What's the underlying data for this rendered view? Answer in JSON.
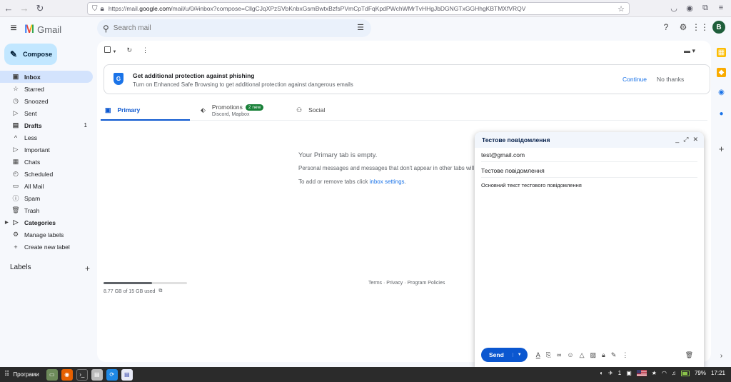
{
  "browser": {
    "url_prefix": "https://mail.",
    "url_host": "google.com",
    "url_rest": "/mail/u/0/#inbox?compose=CllgCJqXPzSVbKnbxGsmBwtxBzfsPVmCpTdFqKpdPWchWMrTvHHgJbDGNGTxGGHhgKBTMXfVRQV"
  },
  "header": {
    "app_name": "Gmail",
    "search_placeholder": "Search mail",
    "avatar_letter": "B"
  },
  "sidebar": {
    "compose_label": "Compose",
    "items": [
      {
        "label": "Inbox",
        "count": ""
      },
      {
        "label": "Starred",
        "count": ""
      },
      {
        "label": "Snoozed",
        "count": ""
      },
      {
        "label": "Sent",
        "count": ""
      },
      {
        "label": "Drafts",
        "count": "1"
      },
      {
        "label": "Less",
        "count": ""
      },
      {
        "label": "Important",
        "count": ""
      },
      {
        "label": "Chats",
        "count": ""
      },
      {
        "label": "Scheduled",
        "count": ""
      },
      {
        "label": "All Mail",
        "count": ""
      },
      {
        "label": "Spam",
        "count": ""
      },
      {
        "label": "Trash",
        "count": ""
      },
      {
        "label": "Categories",
        "count": ""
      },
      {
        "label": "Manage labels",
        "count": ""
      },
      {
        "label": "Create new label",
        "count": ""
      }
    ],
    "labels_heading": "Labels"
  },
  "banner": {
    "title": "Get additional protection against phishing",
    "subtitle": "Turn on Enhanced Safe Browsing to get additional protection against dangerous emails",
    "continue_label": "Continue",
    "no_thanks_label": "No thanks"
  },
  "tabs": {
    "primary": "Primary",
    "promotions": "Promotions",
    "promotions_badge": "2 new",
    "promotions_sub": "Discord, Mapbox",
    "social": "Social"
  },
  "empty_state": {
    "title": "Your Primary tab is empty.",
    "line1": "Personal messages and messages that don't appear in other tabs will be",
    "line2_prefix": "To add or remove tabs click ",
    "line2_link": "inbox settings",
    "line2_suffix": "."
  },
  "storage": {
    "text": "8.77 GB of 15 GB used",
    "used_fraction": 0.585
  },
  "footer": {
    "links": "Terms · Privacy · Program Policies"
  },
  "compose": {
    "title": "Тестове повідомлення",
    "to": "test@gmail.com",
    "subject": "Тестове повідомлення",
    "body": "Основний текст тестового повідомлення",
    "send_label": "Send"
  },
  "taskbar": {
    "start_label": "Програми",
    "counter": "1",
    "battery": "79%",
    "time": "17:21"
  }
}
